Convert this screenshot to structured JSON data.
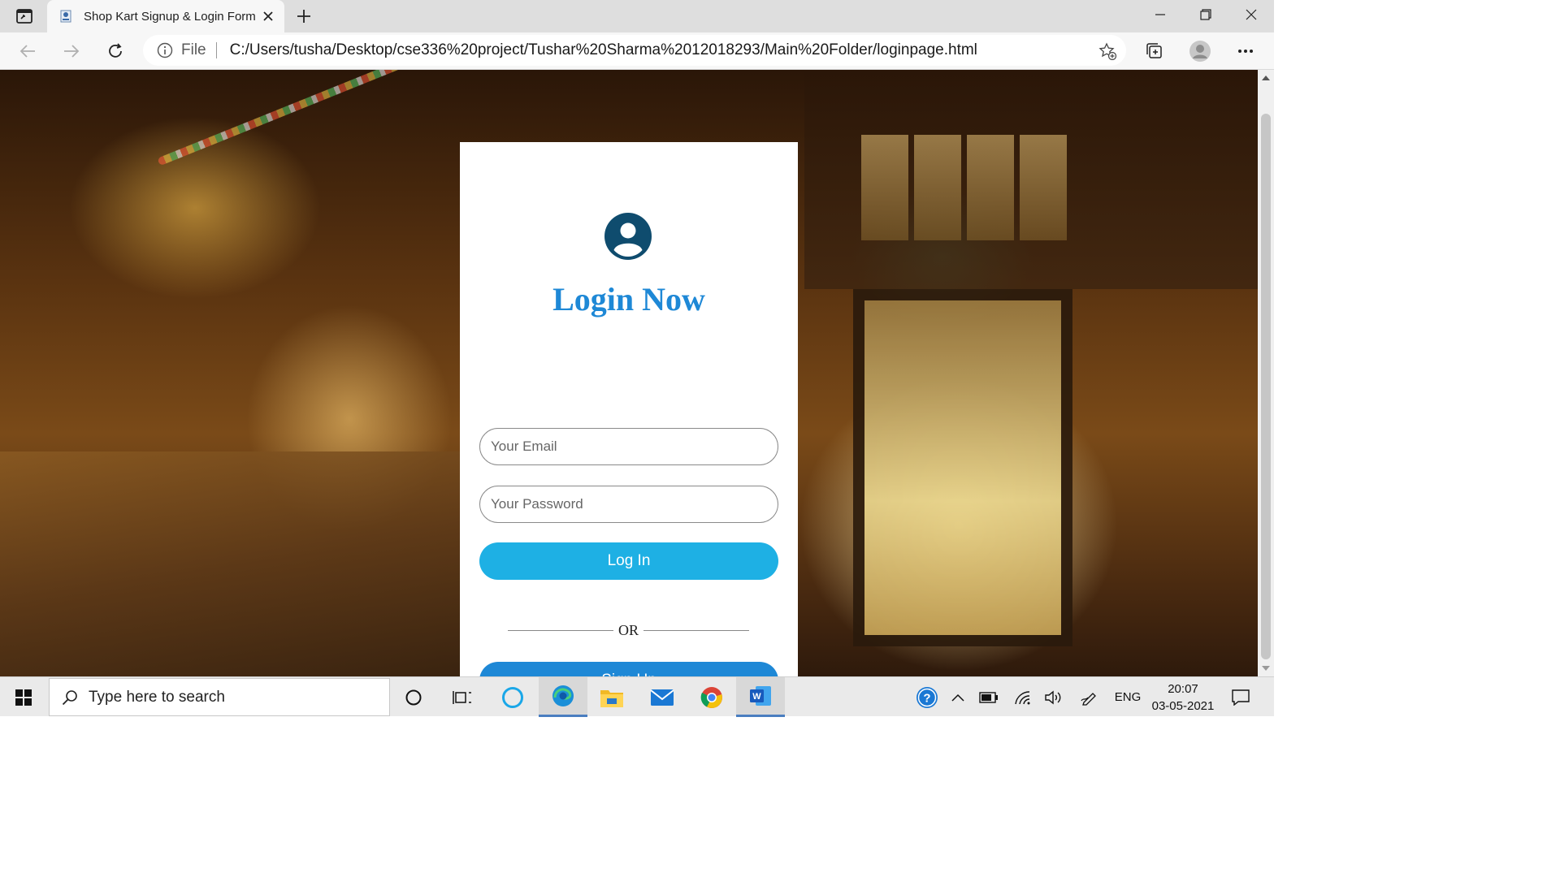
{
  "browser": {
    "tab": {
      "title": "Shop Kart Signup & Login Form"
    },
    "address": {
      "scheme": "File",
      "url": "C:/Users/tusha/Desktop/cse336%20project/Tushar%20Sharma%2012018293/Main%20Folder/loginpage.html"
    }
  },
  "login_card": {
    "title": "Login Now",
    "email_placeholder": "Your Email",
    "password_placeholder": "Your Password",
    "login_label": "Log In",
    "or_label": "OR",
    "signup_label": "Sign Up"
  },
  "taskbar": {
    "search_placeholder": "Type here to search",
    "language": "ENG",
    "time": "20:07",
    "date": "03-05-2021",
    "apps": [
      "cortana",
      "task-view",
      "cortana-circle",
      "edge",
      "file-explorer",
      "mail",
      "chrome",
      "word"
    ]
  },
  "colors": {
    "title_blue": "#1e88d6",
    "login_button": "#1eb0e4",
    "signup_button": "#1e88d6",
    "avatar": "#0f4c6e"
  }
}
